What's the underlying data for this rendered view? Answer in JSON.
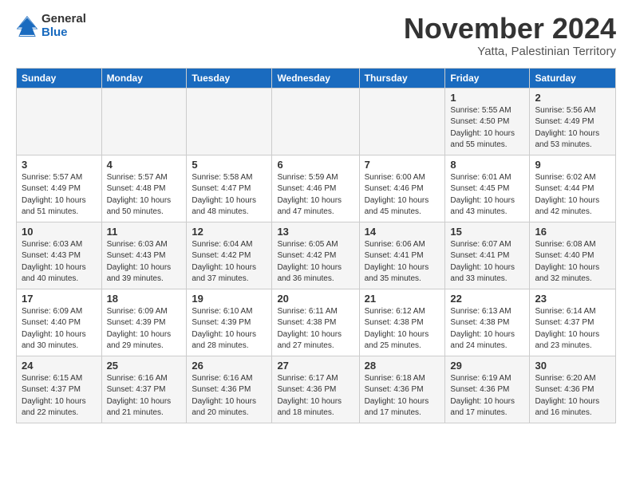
{
  "logo": {
    "general": "General",
    "blue": "Blue"
  },
  "title": "November 2024",
  "subtitle": "Yatta, Palestinian Territory",
  "headers": [
    "Sunday",
    "Monday",
    "Tuesday",
    "Wednesday",
    "Thursday",
    "Friday",
    "Saturday"
  ],
  "weeks": [
    [
      {
        "day": "",
        "info": ""
      },
      {
        "day": "",
        "info": ""
      },
      {
        "day": "",
        "info": ""
      },
      {
        "day": "",
        "info": ""
      },
      {
        "day": "",
        "info": ""
      },
      {
        "day": "1",
        "info": "Sunrise: 5:55 AM\nSunset: 4:50 PM\nDaylight: 10 hours and 55 minutes."
      },
      {
        "day": "2",
        "info": "Sunrise: 5:56 AM\nSunset: 4:49 PM\nDaylight: 10 hours and 53 minutes."
      }
    ],
    [
      {
        "day": "3",
        "info": "Sunrise: 5:57 AM\nSunset: 4:49 PM\nDaylight: 10 hours and 51 minutes."
      },
      {
        "day": "4",
        "info": "Sunrise: 5:57 AM\nSunset: 4:48 PM\nDaylight: 10 hours and 50 minutes."
      },
      {
        "day": "5",
        "info": "Sunrise: 5:58 AM\nSunset: 4:47 PM\nDaylight: 10 hours and 48 minutes."
      },
      {
        "day": "6",
        "info": "Sunrise: 5:59 AM\nSunset: 4:46 PM\nDaylight: 10 hours and 47 minutes."
      },
      {
        "day": "7",
        "info": "Sunrise: 6:00 AM\nSunset: 4:46 PM\nDaylight: 10 hours and 45 minutes."
      },
      {
        "day": "8",
        "info": "Sunrise: 6:01 AM\nSunset: 4:45 PM\nDaylight: 10 hours and 43 minutes."
      },
      {
        "day": "9",
        "info": "Sunrise: 6:02 AM\nSunset: 4:44 PM\nDaylight: 10 hours and 42 minutes."
      }
    ],
    [
      {
        "day": "10",
        "info": "Sunrise: 6:03 AM\nSunset: 4:43 PM\nDaylight: 10 hours and 40 minutes."
      },
      {
        "day": "11",
        "info": "Sunrise: 6:03 AM\nSunset: 4:43 PM\nDaylight: 10 hours and 39 minutes."
      },
      {
        "day": "12",
        "info": "Sunrise: 6:04 AM\nSunset: 4:42 PM\nDaylight: 10 hours and 37 minutes."
      },
      {
        "day": "13",
        "info": "Sunrise: 6:05 AM\nSunset: 4:42 PM\nDaylight: 10 hours and 36 minutes."
      },
      {
        "day": "14",
        "info": "Sunrise: 6:06 AM\nSunset: 4:41 PM\nDaylight: 10 hours and 35 minutes."
      },
      {
        "day": "15",
        "info": "Sunrise: 6:07 AM\nSunset: 4:41 PM\nDaylight: 10 hours and 33 minutes."
      },
      {
        "day": "16",
        "info": "Sunrise: 6:08 AM\nSunset: 4:40 PM\nDaylight: 10 hours and 32 minutes."
      }
    ],
    [
      {
        "day": "17",
        "info": "Sunrise: 6:09 AM\nSunset: 4:40 PM\nDaylight: 10 hours and 30 minutes."
      },
      {
        "day": "18",
        "info": "Sunrise: 6:09 AM\nSunset: 4:39 PM\nDaylight: 10 hours and 29 minutes."
      },
      {
        "day": "19",
        "info": "Sunrise: 6:10 AM\nSunset: 4:39 PM\nDaylight: 10 hours and 28 minutes."
      },
      {
        "day": "20",
        "info": "Sunrise: 6:11 AM\nSunset: 4:38 PM\nDaylight: 10 hours and 27 minutes."
      },
      {
        "day": "21",
        "info": "Sunrise: 6:12 AM\nSunset: 4:38 PM\nDaylight: 10 hours and 25 minutes."
      },
      {
        "day": "22",
        "info": "Sunrise: 6:13 AM\nSunset: 4:38 PM\nDaylight: 10 hours and 24 minutes."
      },
      {
        "day": "23",
        "info": "Sunrise: 6:14 AM\nSunset: 4:37 PM\nDaylight: 10 hours and 23 minutes."
      }
    ],
    [
      {
        "day": "24",
        "info": "Sunrise: 6:15 AM\nSunset: 4:37 PM\nDaylight: 10 hours and 22 minutes."
      },
      {
        "day": "25",
        "info": "Sunrise: 6:16 AM\nSunset: 4:37 PM\nDaylight: 10 hours and 21 minutes."
      },
      {
        "day": "26",
        "info": "Sunrise: 6:16 AM\nSunset: 4:36 PM\nDaylight: 10 hours and 20 minutes."
      },
      {
        "day": "27",
        "info": "Sunrise: 6:17 AM\nSunset: 4:36 PM\nDaylight: 10 hours and 18 minutes."
      },
      {
        "day": "28",
        "info": "Sunrise: 6:18 AM\nSunset: 4:36 PM\nDaylight: 10 hours and 17 minutes."
      },
      {
        "day": "29",
        "info": "Sunrise: 6:19 AM\nSunset: 4:36 PM\nDaylight: 10 hours and 17 minutes."
      },
      {
        "day": "30",
        "info": "Sunrise: 6:20 AM\nSunset: 4:36 PM\nDaylight: 10 hours and 16 minutes."
      }
    ]
  ]
}
